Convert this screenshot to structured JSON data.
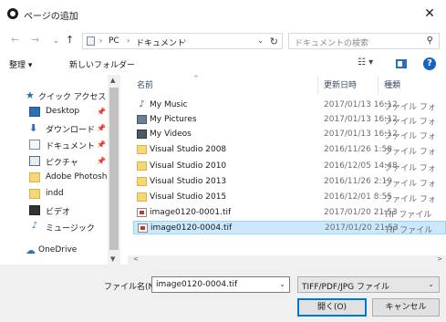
{
  "window": {
    "title": "ページの追加",
    "close_glyph": "✕"
  },
  "nav": {
    "back_glyph": "←",
    "forward_glyph": "→",
    "recent_glyph": "⌄",
    "up_glyph": "↑",
    "breadcrumb": [
      "PC",
      "ドキュメント"
    ],
    "sep_glyph": "›",
    "dropdown_glyph": "⌄",
    "refresh_glyph": "↻",
    "search_placeholder": "ドキュメントの検索",
    "search_glyph": "⚲"
  },
  "toolbar": {
    "organize_label": "整理 ▾",
    "new_folder_label": "新しいフォルダー",
    "view_glyph": "☷ ▾",
    "help_glyph": "?"
  },
  "sidebar": {
    "items": [
      {
        "label": "クイック アクセス",
        "icon": "star-icon",
        "glyph": "★"
      },
      {
        "label": "Desktop",
        "icon": "desktop-icon",
        "pinned": true
      },
      {
        "label": "ダウンロード",
        "icon": "download-icon",
        "glyph": "⬇",
        "pinned": true
      },
      {
        "label": "ドキュメント",
        "icon": "documents-icon",
        "pinned": true
      },
      {
        "label": "ピクチャ",
        "icon": "pictures-icon",
        "pinned": true
      },
      {
        "label": "Adobe Photoshop",
        "icon": "folder-icon"
      },
      {
        "label": "indd",
        "icon": "folder-icon"
      },
      {
        "label": "ビデオ",
        "icon": "videos-icon"
      },
      {
        "label": "ミュージック",
        "icon": "music-icon",
        "glyph": "♪"
      },
      {
        "label": "OneDrive",
        "icon": "onedrive-icon",
        "glyph": "☁"
      }
    ],
    "pin_glyph": "📌"
  },
  "columns": {
    "name": "名前",
    "date": "更新日時",
    "type": "種類",
    "sort_glyph": "^"
  },
  "files": [
    {
      "name": "My Music",
      "date": "2017/01/13 16:12",
      "type": "ファイル フォ",
      "icon": "music-icon",
      "glyph": "♪"
    },
    {
      "name": "My Pictures",
      "date": "2017/01/13 16:12",
      "type": "ファイル フォ",
      "icon": "pictures-library-icon"
    },
    {
      "name": "My Videos",
      "date": "2017/01/13 16:12",
      "type": "ファイル フォ",
      "icon": "videos-library-icon"
    },
    {
      "name": "Visual Studio 2008",
      "date": "2016/11/26 1:58",
      "type": "ファイル フォ",
      "icon": "folder-icon"
    },
    {
      "name": "Visual Studio 2010",
      "date": "2016/12/05 14:48",
      "type": "ファイル フォ",
      "icon": "folder-icon"
    },
    {
      "name": "Visual Studio 2013",
      "date": "2016/11/26 2:19",
      "type": "ファイル フォ",
      "icon": "folder-icon"
    },
    {
      "name": "Visual Studio 2015",
      "date": "2016/12/01 8:55",
      "type": "ファイル フォ",
      "icon": "folder-icon"
    },
    {
      "name": "image0120-0001.tif",
      "date": "2017/01/20 21:53",
      "type": "TIF ファイル",
      "icon": "tif-file-icon"
    },
    {
      "name": "image0120-0004.tif",
      "date": "2017/01/20 21:53",
      "type": "TIF ファイル",
      "icon": "tif-file-icon",
      "selected": true
    }
  ],
  "scroll": {
    "up_glyph": "▲",
    "down_glyph": "▼",
    "left_glyph": "<",
    "right_glyph": ">"
  },
  "footer": {
    "filename_label": "ファイル名(N):",
    "filename_value": "image0120-0004.tif",
    "filename_dropdown_glyph": "⌄",
    "filetype_value": "TIFF/PDF/JPG ファイル",
    "filetype_dropdown_glyph": "⌄",
    "open_label": "開く(O)",
    "cancel_label": "キャンセル"
  },
  "colors": {
    "accent": "#0078d7",
    "selection": "#cce8ff",
    "folder": "#f7d774",
    "help": "#1565c0"
  }
}
